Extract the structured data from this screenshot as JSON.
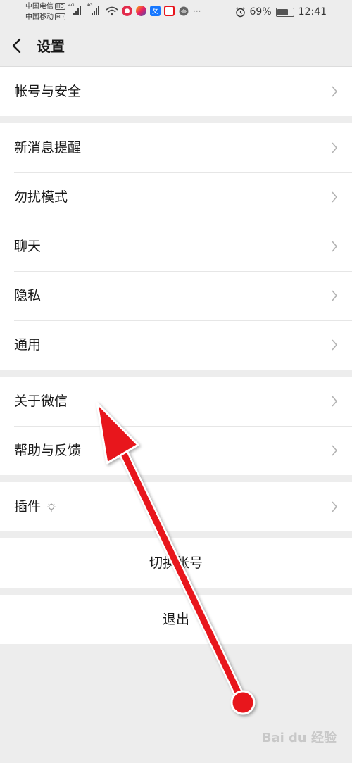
{
  "status_bar": {
    "carrier1": "中国电信",
    "carrier2": "中国移动",
    "hd": "HD",
    "net1": "4G",
    "net2": "4G",
    "battery_pct": "69%",
    "battery_level": 0.69,
    "time": "12:41",
    "icons": [
      "wifi-icon",
      "app-icon-red",
      "app-icon-colorful",
      "app-icon-blue",
      "app-icon-red-square",
      "app-icon-audio",
      "more-dots-icon",
      "alarm-icon",
      "battery-icon"
    ]
  },
  "navbar": {
    "title": "设置"
  },
  "groups": [
    {
      "items": [
        {
          "label": "帐号与安全"
        }
      ]
    },
    {
      "items": [
        {
          "label": "新消息提醒"
        },
        {
          "label": "勿扰模式"
        },
        {
          "label": "聊天"
        },
        {
          "label": "隐私"
        },
        {
          "label": "通用"
        }
      ]
    },
    {
      "items": [
        {
          "label": "关于微信"
        },
        {
          "label": "帮助与反馈"
        }
      ]
    },
    {
      "items": [
        {
          "label": "插件"
        }
      ]
    }
  ],
  "actions": {
    "switch_account": "切换帐号",
    "logout": "退出"
  },
  "watermark": "Bai du 经验",
  "annotation": {
    "color": "#e8141b"
  }
}
